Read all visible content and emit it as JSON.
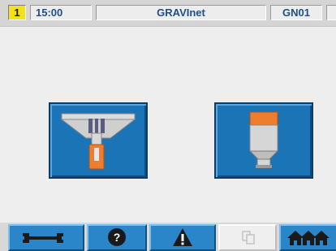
{
  "header": {
    "station_number": "1",
    "time": "15:00",
    "title": "GRAVInet",
    "device_code": "GN01"
  },
  "main": {
    "buttons": [
      {
        "icon": "gravimetric-system-icon"
      },
      {
        "icon": "feeder-hopper-icon"
      }
    ]
  },
  "toolbar": {
    "buttons": [
      {
        "icon": "wrench-icon",
        "enabled": true
      },
      {
        "icon": "help-icon",
        "enabled": true
      },
      {
        "icon": "warning-icon",
        "enabled": true
      },
      {
        "icon": "copy-icon",
        "enabled": false
      },
      {
        "icon": "home-icon",
        "enabled": true
      }
    ]
  },
  "colors": {
    "header_bg": "#d5d5d5",
    "header_text": "#1d4f8a",
    "station_badge": "#f2e21c",
    "button_blue": "#1b74b6",
    "accent_orange": "#ee7d2f"
  }
}
